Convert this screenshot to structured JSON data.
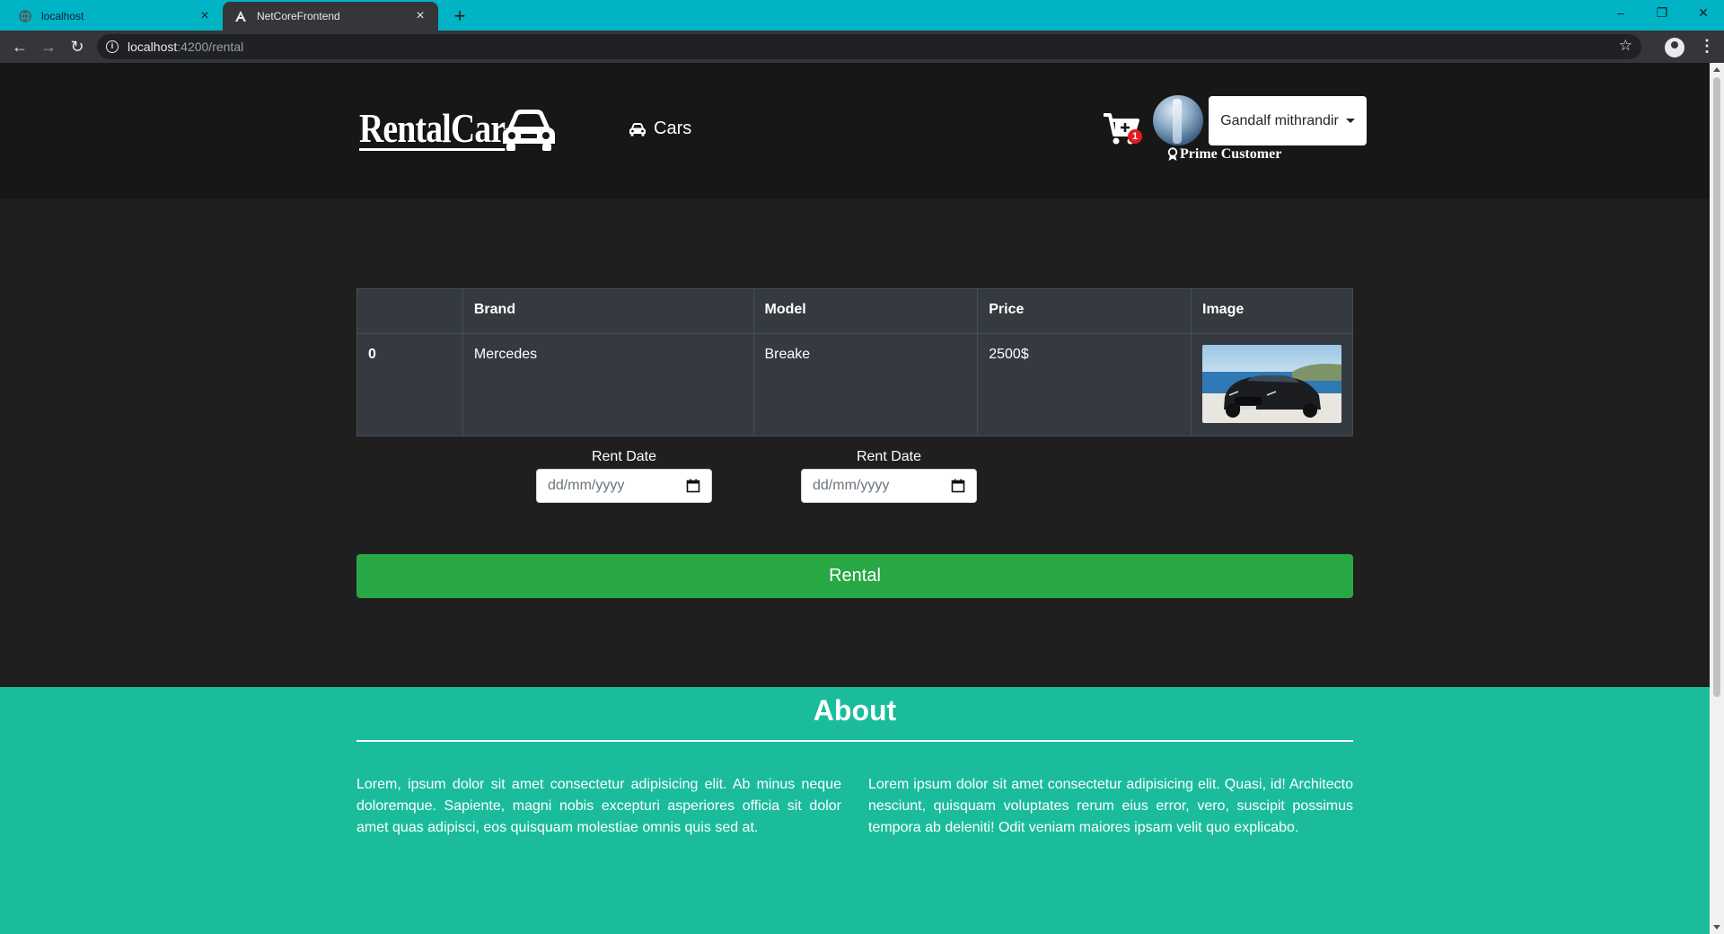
{
  "browser": {
    "tabs": [
      {
        "title": "localhost",
        "active": false
      },
      {
        "title": "NetCoreFrontend",
        "active": true
      }
    ],
    "url_host": "localhost",
    "url_path": ":4200/rental",
    "tab_bar_color": "#00b3c5"
  },
  "navbar": {
    "logo_text": "RentalCar",
    "cars_link": "Cars",
    "cart_count": "1",
    "user_name": "Gandalf mithrandir",
    "user_badge": "Prime Customer"
  },
  "table": {
    "headers": [
      "",
      "Brand",
      "Model",
      "Price",
      "Image"
    ],
    "rows": [
      {
        "index": "0",
        "brand": "Mercedes",
        "model": "Breake",
        "price": "2500$"
      }
    ]
  },
  "rent_dates": [
    {
      "label": "Rent Date",
      "placeholder": "dd/mm/yyyy"
    },
    {
      "label": "Rent Date",
      "placeholder": "dd/mm/yyyy"
    }
  ],
  "rental_button": "Rental",
  "about": {
    "title": "About",
    "col1": "Lorem, ipsum dolor sit amet consectetur adipisicing elit. Ab minus neque doloremque. Sapiente, magni nobis excepturi asperiores officia sit dolor amet quas adipisci, eos quisquam molestiae omnis quis sed at.",
    "col2": "Lorem ipsum dolor sit amet consectetur adipisicing elit. Quasi, id! Architecto nesciunt, quisquam voluptates rerum eius error, vero, suscipit possimus tempora ab deleniti! Odit veniam maiores ipsam velit quo explicabo."
  },
  "colors": {
    "navbar_bg": "#171717",
    "page_bg": "#1f1f1f",
    "table_bg": "#343a40",
    "rental_button": "#28a745",
    "about_bg": "#1abc9c"
  }
}
